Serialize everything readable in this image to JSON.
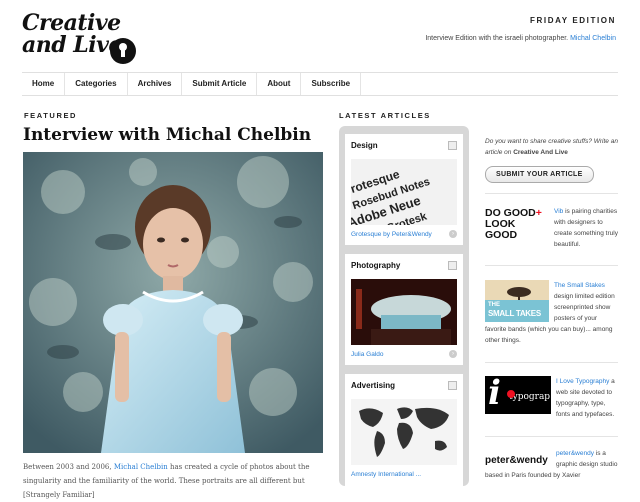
{
  "logo": {
    "line1": "Creative",
    "line2": "and Live"
  },
  "edition": {
    "title": "FRIDAY EDITION",
    "desc_prefix": "Interview Edition with the israeli photographer. ",
    "desc_link": "Michal Chelbin"
  },
  "nav": [
    "Home",
    "Categories",
    "Archives",
    "Submit Article",
    "About",
    "Subscribe"
  ],
  "featured": {
    "label": "FEATURED",
    "title": "Interview with Michal Chelbin",
    "text_prefix": "Between 2003 and 2006, ",
    "text_link": "Michal Chelbin",
    "text_suffix": " has created a cycle of photos about the singularity and the familiarity of the world. These portraits are all different but [Strangely Familiar]"
  },
  "latest": {
    "label": "LATEST ARTICLES",
    "cards": [
      {
        "category": "Design",
        "link": "Grotesque by Peter&Wendy"
      },
      {
        "category": "Photography",
        "link": "Julia Galdo"
      },
      {
        "category": "Advertising",
        "link": "Amnesty International ..."
      }
    ]
  },
  "sidebar": {
    "share": {
      "text": "Do you want to share creative stuffs? Write an article on ",
      "bold": "Creative And Live",
      "button": "SUBMIT YOUR ARTICLE"
    },
    "vib": {
      "logo_line1": "DO GOOD",
      "logo_plus": "+",
      "logo_line2": "LOOK GOOD",
      "link": "Vib",
      "text": " is pairing charities with designers to create something truly beautiful."
    },
    "small_stakes": {
      "logo_line1": "THE",
      "logo_line2": "SMALL TAKES",
      "link": "The Small Stakes",
      "text": " design limited edition screenprinted show posters of your favorite bands (which you can buy)... among other things."
    },
    "typography": {
      "logo_i": "i",
      "logo_word": "typograp",
      "link": "I Love Typography",
      "text": " a web site devoted to typography, type, fonts and typefaces."
    },
    "peterwendy": {
      "logo": "peter&wendy",
      "link": "peter&wendy",
      "text": " is a graphic design studio based in Paris founded by Xavier"
    }
  },
  "colors": {
    "link": "#2a7fd4",
    "plus_red": "#e12222",
    "panel_gray": "#d7d7d7"
  }
}
